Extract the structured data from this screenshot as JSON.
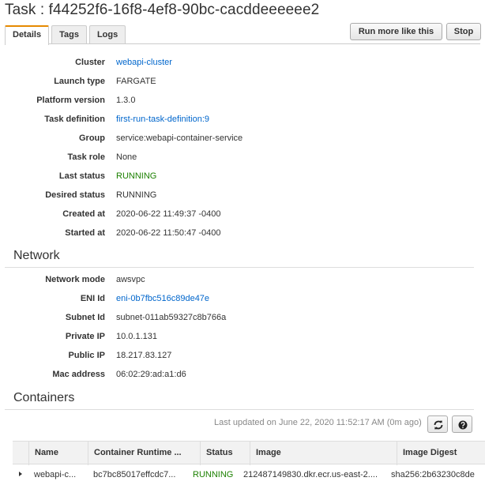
{
  "header": {
    "title": "Task : f44252f6-16f8-4ef8-90bc-cacddeeeeee2",
    "run_more_label": "Run more like this",
    "stop_label": "Stop"
  },
  "tabs": [
    {
      "label": "Details",
      "active": true
    },
    {
      "label": "Tags",
      "active": false
    },
    {
      "label": "Logs",
      "active": false
    }
  ],
  "details": {
    "cluster": {
      "label": "Cluster",
      "value": "webapi-cluster"
    },
    "launch_type": {
      "label": "Launch type",
      "value": "FARGATE"
    },
    "platform_version": {
      "label": "Platform version",
      "value": "1.3.0"
    },
    "task_definition": {
      "label": "Task definition",
      "value": "first-run-task-definition:9"
    },
    "group": {
      "label": "Group",
      "value": "service:webapi-container-service"
    },
    "task_role": {
      "label": "Task role",
      "value": "None"
    },
    "last_status": {
      "label": "Last status",
      "value": "RUNNING"
    },
    "desired_status": {
      "label": "Desired status",
      "value": "RUNNING"
    },
    "created_at": {
      "label": "Created at",
      "value": "2020-06-22 11:49:37 -0400"
    },
    "started_at": {
      "label": "Started at",
      "value": "2020-06-22 11:50:47 -0400"
    }
  },
  "network": {
    "title": "Network",
    "network_mode": {
      "label": "Network mode",
      "value": "awsvpc"
    },
    "eni_id": {
      "label": "ENI Id",
      "value": "eni-0b7fbc516c89de47e"
    },
    "subnet_id": {
      "label": "Subnet Id",
      "value": "subnet-011ab59327c8b766a"
    },
    "private_ip": {
      "label": "Private IP",
      "value": "10.0.1.131"
    },
    "public_ip": {
      "label": "Public IP",
      "value": "18.217.83.127"
    },
    "mac_address": {
      "label": "Mac address",
      "value": "06:02:29:ad:a1:d6"
    }
  },
  "containers": {
    "title": "Containers",
    "last_updated": "Last updated on June 22, 2020 11:52:17 AM (0m ago)",
    "columns": [
      "Name",
      "Container Runtime ...",
      "Status",
      "Image",
      "Image Digest"
    ],
    "rows": [
      {
        "name": "webapi-c...",
        "runtime": "bc7bc85017effcdc7...",
        "status": "RUNNING",
        "image": "212487149830.dkr.ecr.us-east-2....",
        "digest": "sha256:2b63230c8de"
      }
    ]
  },
  "icons": {
    "refresh": "refresh-icon",
    "help": "help-icon",
    "expand": "expand-caret-icon"
  },
  "colors": {
    "link": "#0066cc",
    "running": "#1d8102",
    "active_tab_accent": "#e68a00"
  }
}
